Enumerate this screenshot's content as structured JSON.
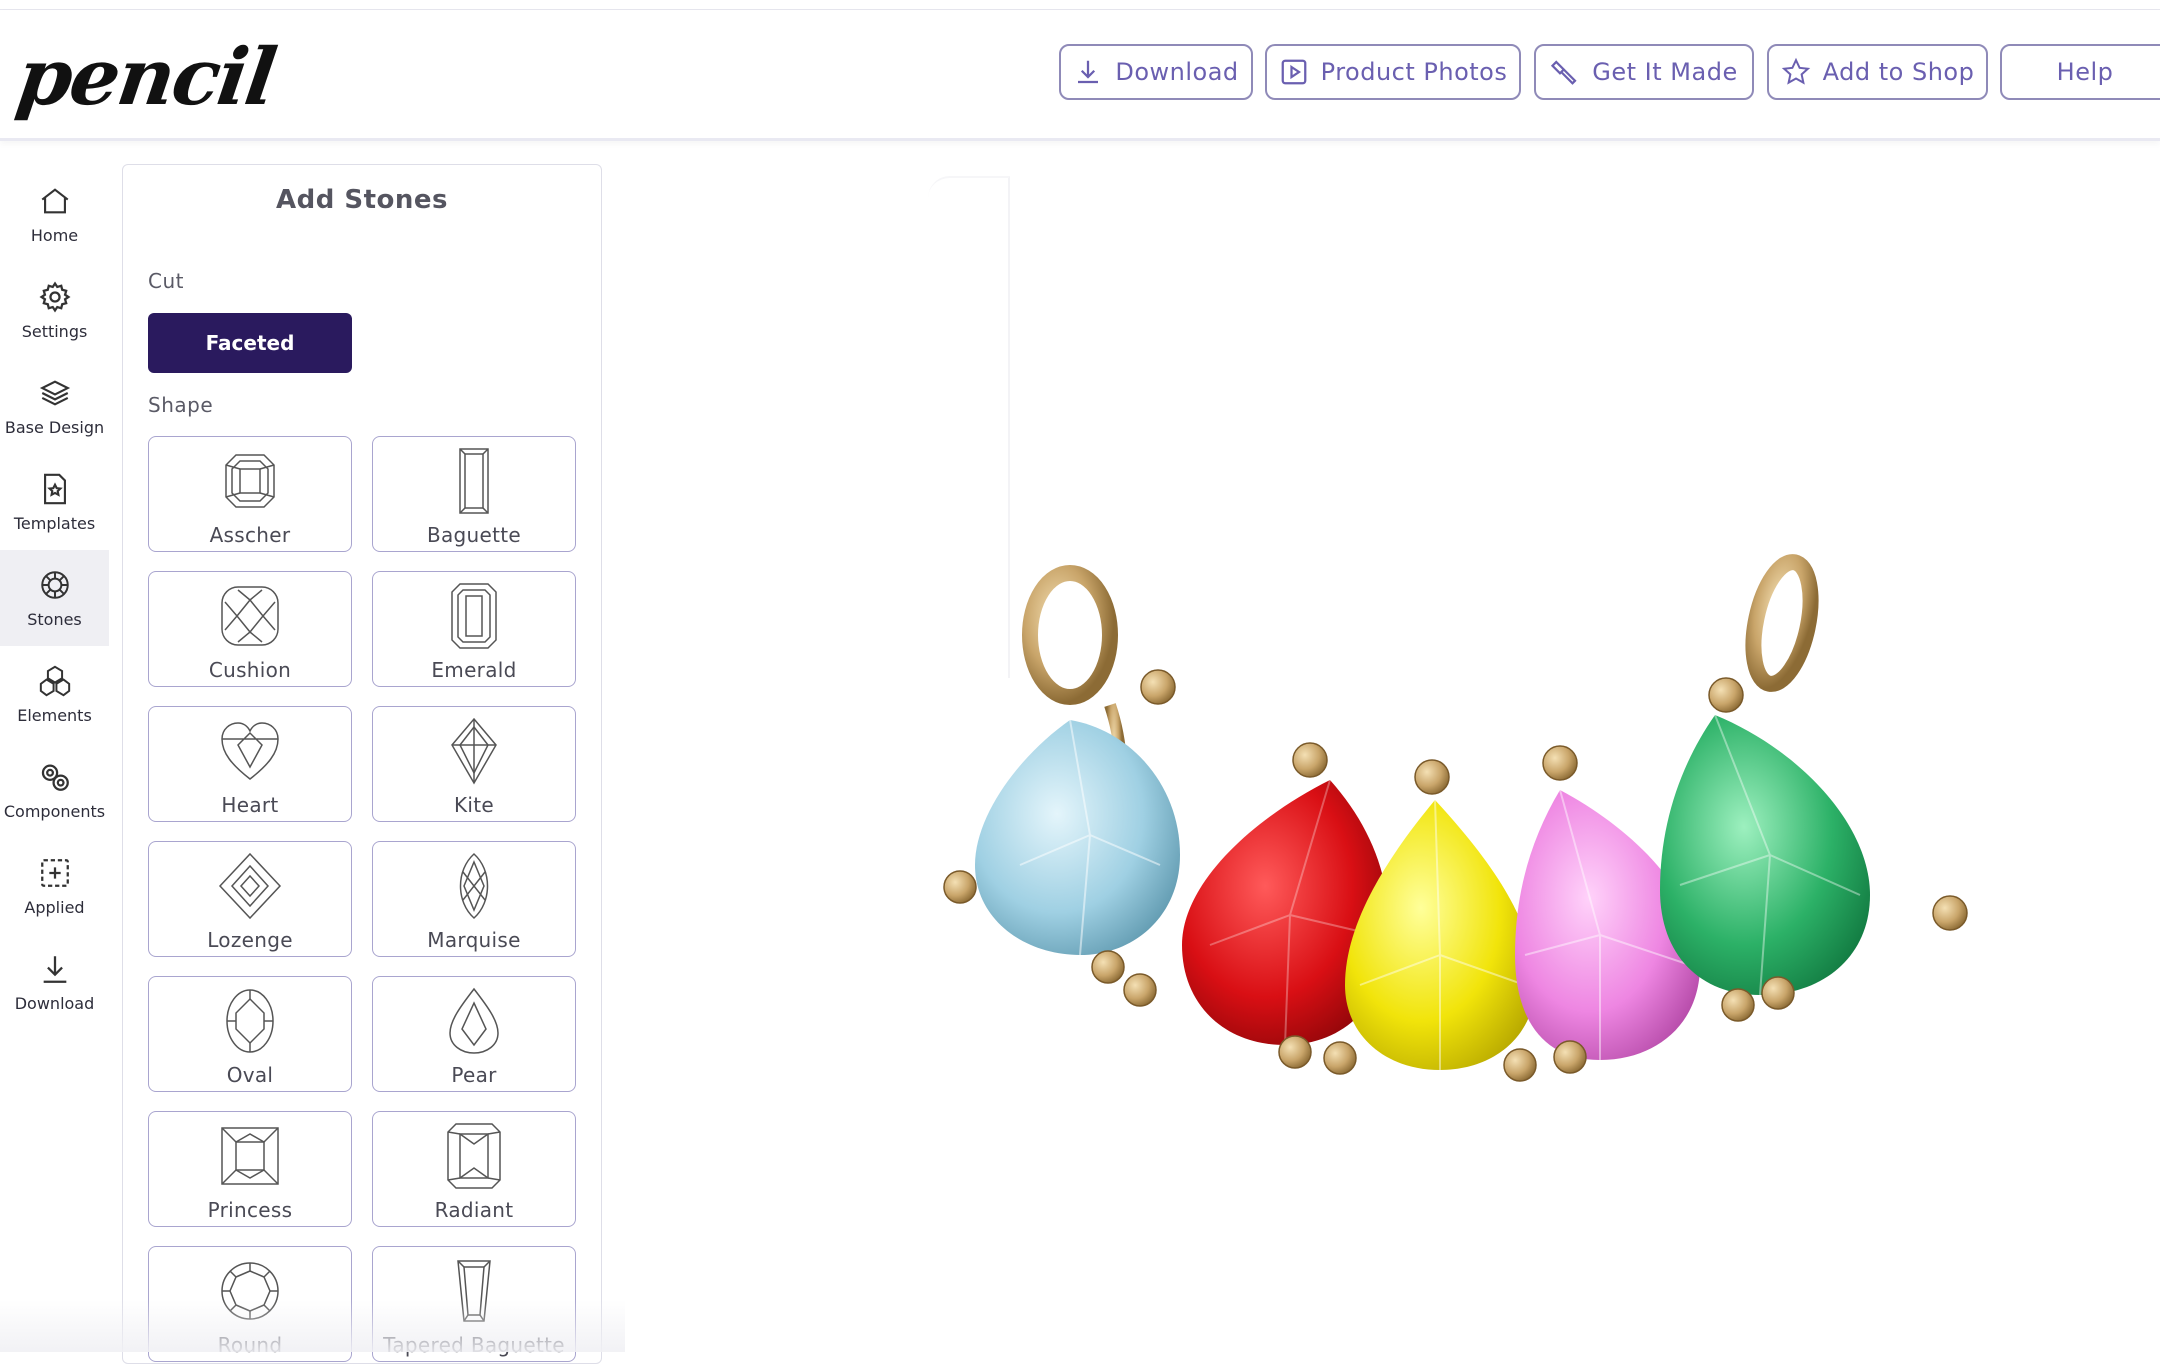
{
  "header": {
    "logo": "pencil",
    "buttons": {
      "download": "Download",
      "product_photos": "Product Photos",
      "get_it_made": "Get It Made",
      "add_to_shop": "Add to Shop",
      "help": "Help"
    }
  },
  "nav": {
    "items": [
      {
        "label": "Home",
        "icon": "home-icon"
      },
      {
        "label": "Settings",
        "icon": "gear-icon"
      },
      {
        "label": "Base Design",
        "icon": "layers-icon"
      },
      {
        "label": "Templates",
        "icon": "template-icon"
      },
      {
        "label": "Stones",
        "icon": "gem-icon"
      },
      {
        "label": "Elements",
        "icon": "elements-icon"
      },
      {
        "label": "Components",
        "icon": "components-icon"
      },
      {
        "label": "Applied",
        "icon": "applied-icon"
      },
      {
        "label": "Download",
        "icon": "download-icon"
      }
    ],
    "active": "Stones"
  },
  "panel": {
    "title": "Add Stones",
    "cut_label": "Cut",
    "cut_selected": "Faceted",
    "shape_label": "Shape",
    "shapes": [
      "Asscher",
      "Baguette",
      "Cushion",
      "Emerald",
      "Heart",
      "Kite",
      "Lozenge",
      "Marquise",
      "Oval",
      "Pear",
      "Princess",
      "Radiant",
      "Round",
      "Tapered Baguette"
    ]
  },
  "canvas": {
    "stones": [
      {
        "shape": "pear",
        "color": "#a9d8ea"
      },
      {
        "shape": "pear",
        "color": "#e0141a"
      },
      {
        "shape": "pear",
        "color": "#f5ea12"
      },
      {
        "shape": "pear",
        "color": "#f08de6"
      },
      {
        "shape": "pear",
        "color": "#2fb56c"
      }
    ],
    "metal_color": "#c9a56a",
    "accent_color": "#2a1a5e"
  }
}
